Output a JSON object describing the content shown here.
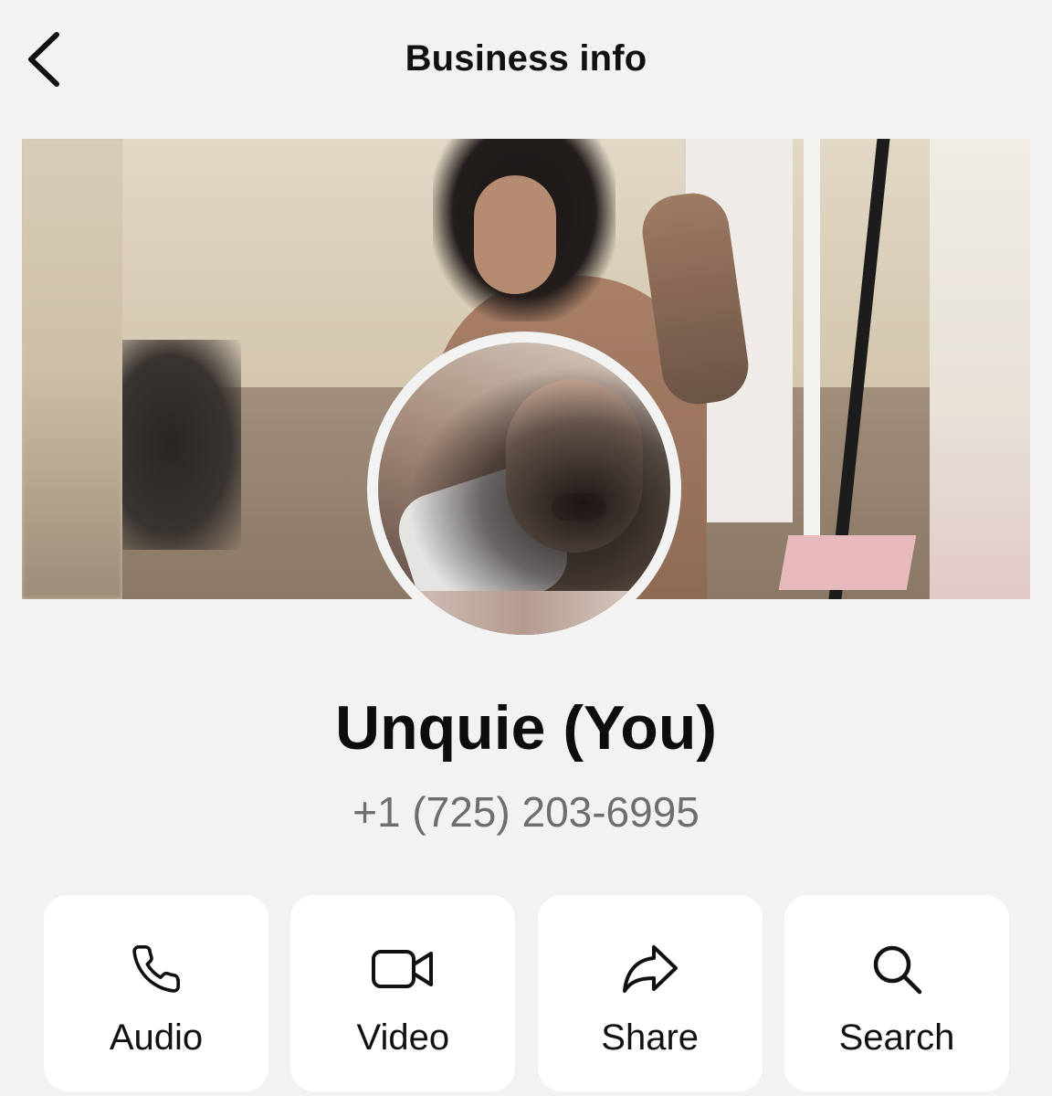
{
  "header": {
    "title": "Business info",
    "back_icon": "chevron-left-icon"
  },
  "profile": {
    "name": "Unquie (You)",
    "phone": "+1 (725) 203-6995"
  },
  "actions": [
    {
      "label": "Audio",
      "icon": "phone-icon"
    },
    {
      "label": "Video",
      "icon": "video-camera-icon"
    },
    {
      "label": "Share",
      "icon": "share-arrow-icon"
    },
    {
      "label": "Search",
      "icon": "search-icon"
    }
  ],
  "colors": {
    "background": "#f2f2f2",
    "card": "#ffffff",
    "text": "#111111",
    "secondary_text": "#6e6e6e"
  }
}
